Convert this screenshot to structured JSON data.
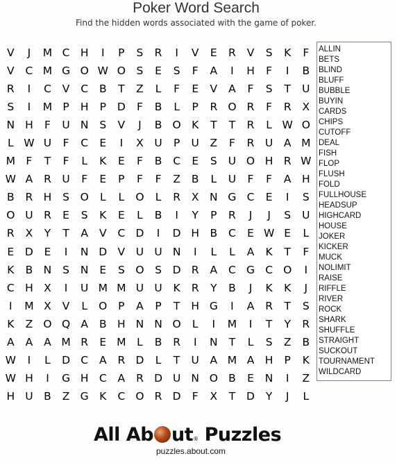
{
  "header": {
    "title": "Poker Word Search",
    "subtitle": "Find the hidden words associated with the game of poker."
  },
  "grid": [
    [
      "V",
      "J",
      "M",
      "C",
      "H",
      "I",
      "P",
      "S",
      "R",
      "I",
      "V",
      "E",
      "R",
      "V",
      "S",
      "K",
      "F"
    ],
    [
      "V",
      "C",
      "M",
      "G",
      "O",
      "W",
      "O",
      "S",
      "E",
      "S",
      "F",
      "A",
      "I",
      "H",
      "F",
      "I",
      "B"
    ],
    [
      "R",
      "I",
      "C",
      "V",
      "C",
      "B",
      "T",
      "Z",
      "L",
      "F",
      "E",
      "V",
      "A",
      "F",
      "S",
      "T",
      "U"
    ],
    [
      "S",
      "I",
      "M",
      "P",
      "H",
      "P",
      "D",
      "F",
      "B",
      "L",
      "P",
      "R",
      "O",
      "R",
      "F",
      "R",
      "X"
    ],
    [
      "N",
      "H",
      "F",
      "U",
      "N",
      "S",
      "V",
      "J",
      "B",
      "O",
      "K",
      "T",
      "T",
      "R",
      "L",
      "W",
      "O"
    ],
    [
      "L",
      "W",
      "U",
      "F",
      "C",
      "E",
      "I",
      "X",
      "U",
      "P",
      "U",
      "Z",
      "F",
      "R",
      "U",
      "A",
      "M"
    ],
    [
      "M",
      "F",
      "T",
      "F",
      "L",
      "K",
      "E",
      "F",
      "B",
      "C",
      "E",
      "S",
      "U",
      "O",
      "H",
      "R",
      "W"
    ],
    [
      "W",
      "A",
      "R",
      "U",
      "F",
      "E",
      "P",
      "F",
      "F",
      "Z",
      "B",
      "L",
      "U",
      "F",
      "F",
      "A",
      "H"
    ],
    [
      "B",
      "R",
      "H",
      "S",
      "O",
      "L",
      "L",
      "O",
      "L",
      "R",
      "X",
      "N",
      "G",
      "C",
      "E",
      "I",
      "S"
    ],
    [
      "O",
      "U",
      "R",
      "E",
      "S",
      "K",
      "E",
      "L",
      "B",
      "I",
      "Y",
      "P",
      "R",
      "J",
      "J",
      "S",
      "U"
    ],
    [
      "R",
      "X",
      "Y",
      "T",
      "A",
      "V",
      "C",
      "D",
      "I",
      "D",
      "H",
      "B",
      "C",
      "E",
      "W",
      "E",
      "L"
    ],
    [
      "E",
      "D",
      "E",
      "I",
      "N",
      "D",
      "V",
      "U",
      "U",
      "N",
      "I",
      "L",
      "L",
      "A",
      "K",
      "T",
      "F"
    ],
    [
      "K",
      "B",
      "N",
      "S",
      "N",
      "E",
      "S",
      "O",
      "S",
      "D",
      "R",
      "A",
      "C",
      "G",
      "C",
      "O",
      "I"
    ],
    [
      "C",
      "H",
      "X",
      "I",
      "U",
      "M",
      "M",
      "U",
      "U",
      "K",
      "R",
      "Y",
      "B",
      "J",
      "K",
      "K",
      "J"
    ],
    [
      "I",
      "M",
      "X",
      "V",
      "L",
      "O",
      "P",
      "A",
      "P",
      "T",
      "H",
      "G",
      "I",
      "A",
      "R",
      "T",
      "S"
    ],
    [
      "K",
      "Z",
      "O",
      "Q",
      "A",
      "B",
      "H",
      "N",
      "N",
      "O",
      "L",
      "I",
      "M",
      "I",
      "T",
      "Y",
      "R"
    ],
    [
      "A",
      "A",
      "A",
      "M",
      "R",
      "E",
      "M",
      "L",
      "B",
      "R",
      "I",
      "N",
      "T",
      "L",
      "S",
      "Z",
      "B"
    ],
    [
      "W",
      "I",
      "L",
      "D",
      "C",
      "A",
      "R",
      "D",
      "L",
      "T",
      "U",
      "A",
      "M",
      "A",
      "H",
      "P",
      "K"
    ],
    [
      "W",
      "H",
      "I",
      "G",
      "H",
      "C",
      "A",
      "R",
      "D",
      "U",
      "N",
      "O",
      "B",
      "E",
      "N",
      "I",
      "Z"
    ],
    [
      "H",
      "U",
      "B",
      "Z",
      "G",
      "K",
      "C",
      "O",
      "R",
      "D",
      "F",
      "X",
      "T",
      "D",
      "Y",
      "J",
      "L"
    ]
  ],
  "words": [
    "ALLIN",
    "BETS",
    "BLIND",
    "BLUFF",
    "BUBBLE",
    "BUYIN",
    "CARDS",
    "CHIPS",
    "CUTOFF",
    "DEAL",
    "FISH",
    "FLOP",
    "FLUSH",
    "FOLD",
    "FULLHOUSE",
    "HEADSUP",
    "HIGHCARD",
    "HOUSE",
    "JOKER",
    "KICKER",
    "MUCK",
    "NOLIMIT",
    "RAISE",
    "RIFFLE",
    "RIVER",
    "ROCK",
    "SHARK",
    "SHUFFLE",
    "STRAIGHT",
    "SUCKOUT",
    "TOURNAMENT",
    "WILDCARD"
  ],
  "footer": {
    "logo_part1": "All Ab",
    "logo_part2": "ut",
    "logo_reg": "®",
    "logo_part3": "Puzzles",
    "url": "puzzles.about.com"
  }
}
